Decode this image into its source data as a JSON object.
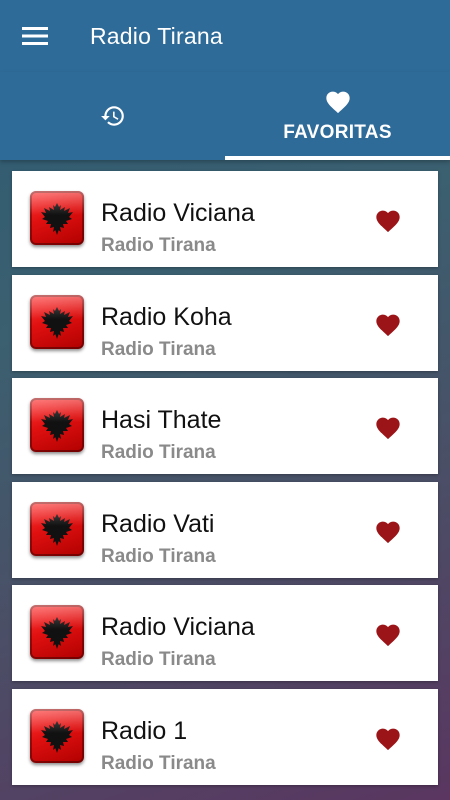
{
  "app": {
    "title": "Radio Tirana"
  },
  "tabs": [
    {
      "icon": "history-icon",
      "label": ""
    },
    {
      "icon": "heart-icon",
      "label": "FAVORITAS",
      "selected": true
    }
  ],
  "colors": {
    "primary": "#2f6b99",
    "heart": "#9b1518",
    "flag_red": "#e01010"
  },
  "stations": [
    {
      "name": "Radio Viciana",
      "subtitle": "Radio Tirana"
    },
    {
      "name": "Radio Koha",
      "subtitle": "Radio Tirana"
    },
    {
      "name": "Hasi Thate",
      "subtitle": "Radio Tirana"
    },
    {
      "name": "Radio Vati",
      "subtitle": "Radio Tirana"
    },
    {
      "name": "Radio Viciana",
      "subtitle": "Radio Tirana"
    },
    {
      "name": "Radio 1",
      "subtitle": "Radio Tirana"
    }
  ]
}
